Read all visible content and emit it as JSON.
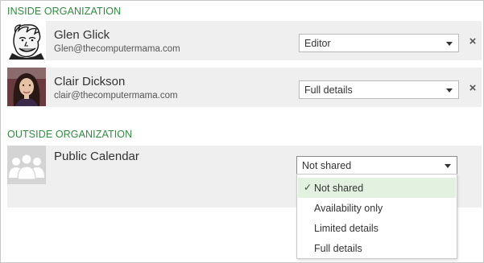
{
  "inside_section": {
    "title": "INSIDE ORGANIZATION",
    "people": [
      {
        "name": "Glen Glick",
        "email": "Glen@thecomputermama.com",
        "permission": "Editor",
        "avatar_icon": "cartoon-face-avatar"
      },
      {
        "name": "Clair Dickson",
        "email": "clair@thecomputermama.com",
        "permission": "Full details",
        "avatar_icon": "photo-avatar"
      }
    ]
  },
  "outside_section": {
    "title": "OUTSIDE ORGANIZATION",
    "public_calendar": {
      "name": "Public Calendar",
      "permission": "Not shared",
      "avatar_icon": "group-icon"
    }
  },
  "dropdown_menu": {
    "options": [
      "Not shared",
      "Availability only",
      "Limited details",
      "Full details"
    ],
    "selected": "Not shared"
  },
  "icons": {
    "remove": "close-icon",
    "caret": "chevron-down-icon",
    "check": "checkmark-icon"
  },
  "colors": {
    "section_title": "#2e8b3d",
    "row_background": "#efefef",
    "selected_option": "#e3f1e1"
  }
}
